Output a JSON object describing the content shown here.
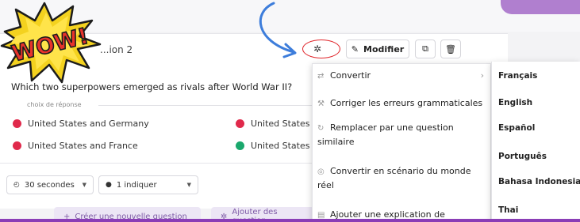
{
  "question": {
    "number_label": "...ion 2",
    "text": "Which two superpowers emerged as rivals after World War II?",
    "choices_label": "choix de réponse",
    "choices": [
      {
        "label": "United States and Germany",
        "color": "#e0294b"
      },
      {
        "label": "United States",
        "color": "#e0294b"
      },
      {
        "label": "United States and France",
        "color": "#e0294b"
      },
      {
        "label": "United States",
        "color": "#1aa86d"
      }
    ]
  },
  "toolbar": {
    "edit_label": "Modifier",
    "magic_icon": "magic-wand-icon",
    "copy_icon": "copy-icon",
    "delete_icon": "trash-icon"
  },
  "settings": {
    "time_value": "30 secondes",
    "hint_value": "1 indiquer"
  },
  "actions": {
    "create_label": "Créer une nouvelle question",
    "add_label": "Ajouter des question"
  },
  "menu": {
    "items": [
      {
        "icon": "convert-icon",
        "label": "Convertir"
      },
      {
        "icon": "wrench-icon",
        "label": "Corriger les erreurs grammaticales"
      },
      {
        "icon": "replace-icon",
        "line1": "Remplacer par une question",
        "line2": "similaire"
      },
      {
        "icon": "scenario-icon",
        "line1": "Convertir en scénario du monde",
        "line2": "réel"
      },
      {
        "icon": "explanation-icon",
        "label": "Ajouter une explication de"
      }
    ]
  },
  "languages": [
    "Français",
    "English",
    "Español",
    "Português",
    "Bahasa Indonesia",
    "Thai"
  ],
  "sticker": {
    "text": "WOW!"
  },
  "colors": {
    "accent": "#8a3db6",
    "correct": "#1aa86d",
    "wrong": "#e0294b",
    "highlight_circle": "#e0262b"
  }
}
